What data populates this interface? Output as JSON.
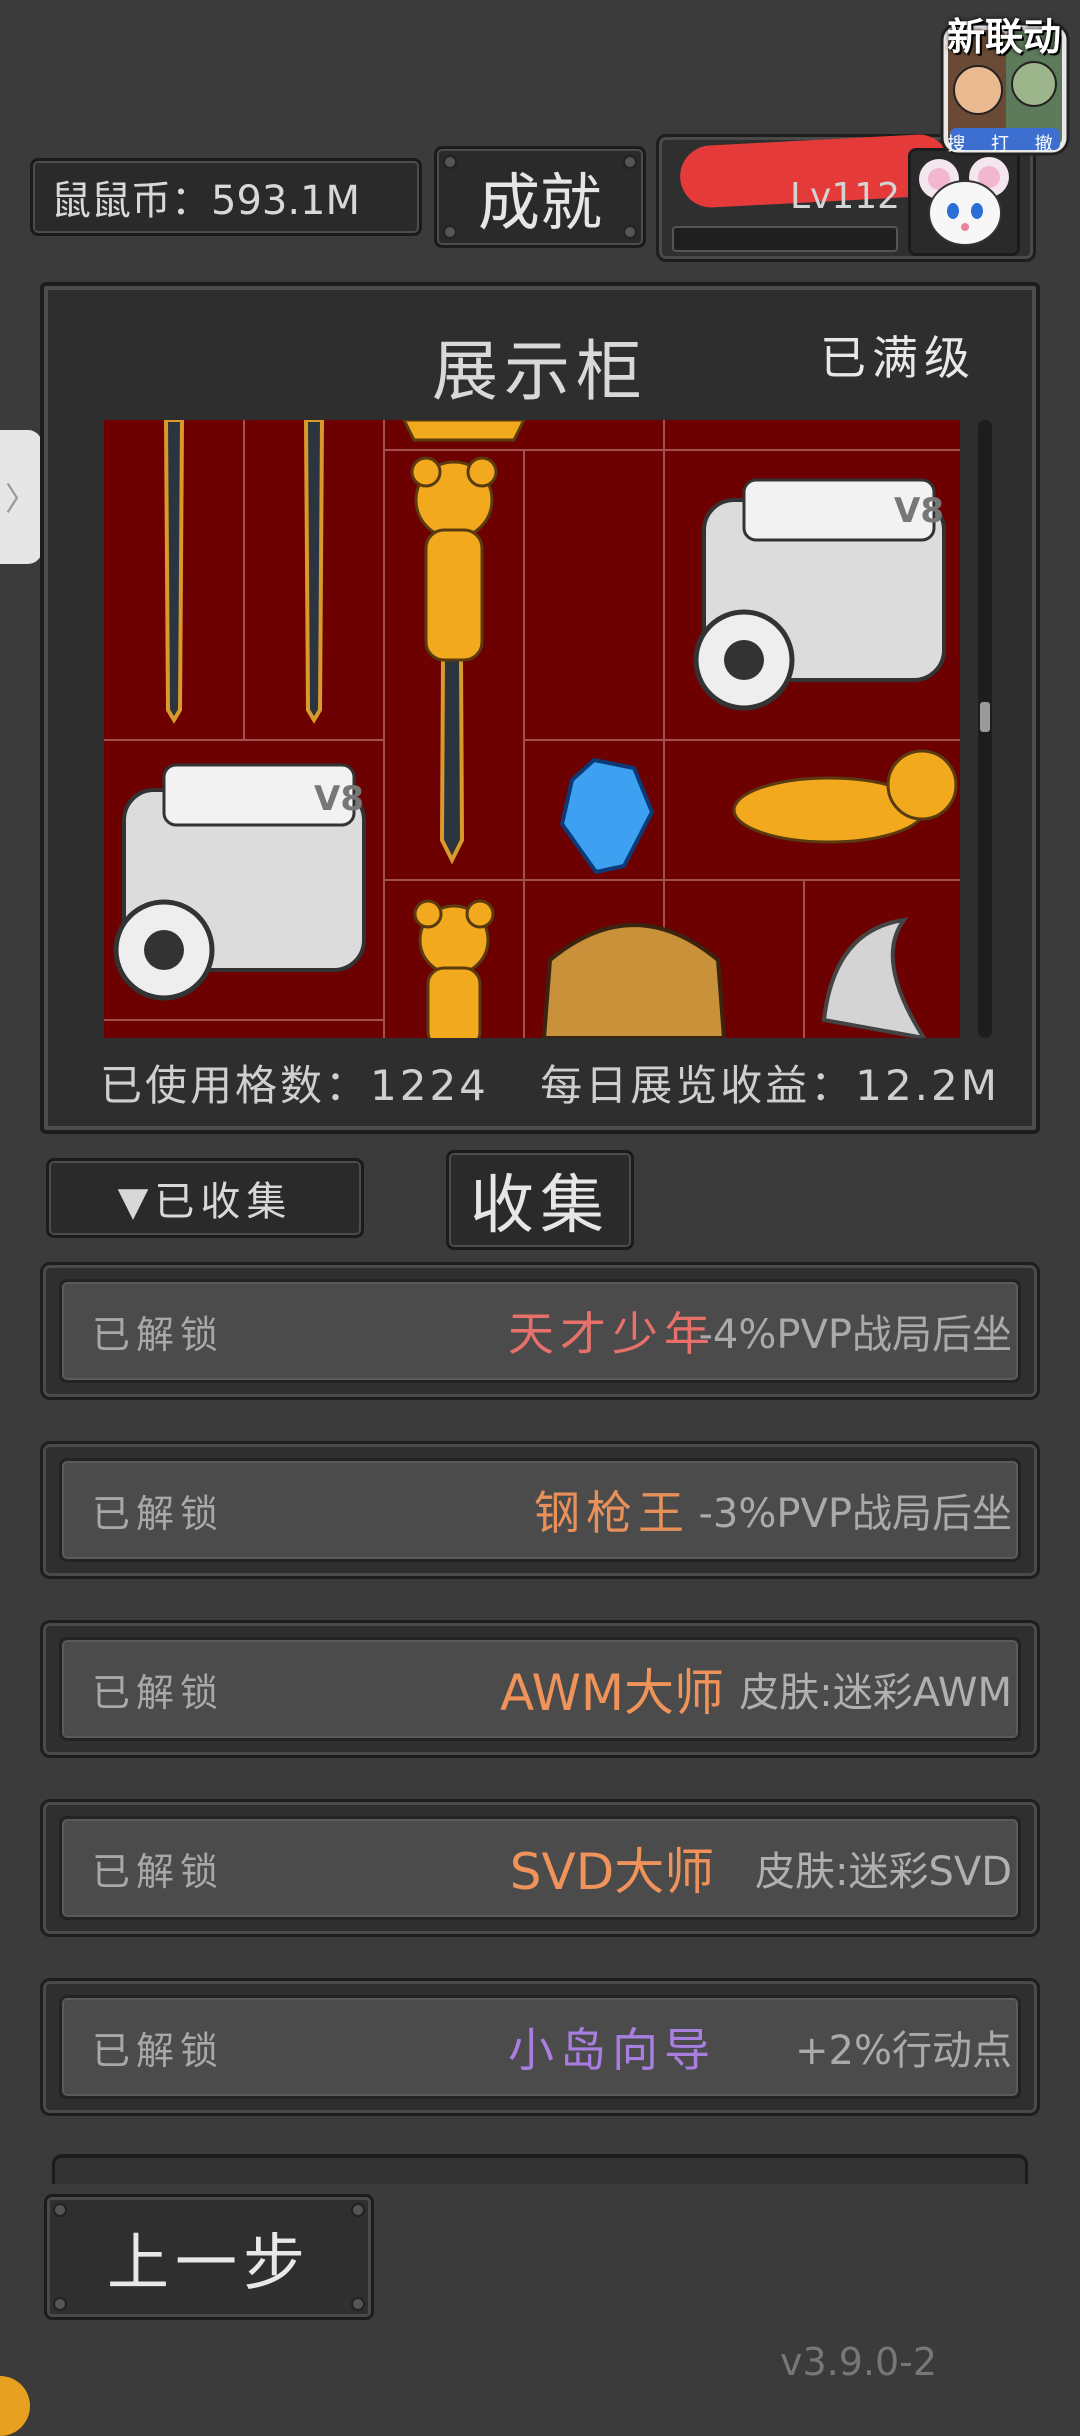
{
  "top_bar": {
    "coin_label": "鼠鼠币：593.1M",
    "achievement_button": "成就",
    "player_level": "Lv112",
    "event_label": "新联动",
    "event_sublabels": "搜 打 撤"
  },
  "cabinet": {
    "title": "展示柜",
    "status": "已满级",
    "used_slots_label": "已使用格数：1224",
    "daily_income_label": "每日展览收益：12.2M"
  },
  "tabs": {
    "collected_dropdown": "▼已收集",
    "collect_button": "收集"
  },
  "achievements": [
    {
      "status": "已解锁",
      "title": "天才少年",
      "reward": "-4%PVP战局后坐",
      "color": "#e8706a"
    },
    {
      "status": "已解锁",
      "title": "钢枪王",
      "reward": "-3%PVP战局后坐",
      "color": "#e8905a"
    },
    {
      "status": "已解锁",
      "title": "AWM大师",
      "reward": "皮肤:迷彩AWM",
      "color": "#f0935a"
    },
    {
      "status": "已解锁",
      "title": "SVD大师",
      "reward": "皮肤:迷彩SVD",
      "color": "#f0935a"
    },
    {
      "status": "已解锁",
      "title": "小岛向导",
      "reward": "+2%行动点",
      "color": "#a87fe0"
    }
  ],
  "bottom": {
    "back_button": "上一步",
    "version": "v3.9.0-2"
  },
  "colors": {
    "background": "#3b3b3b",
    "grid_background": "#6d0000",
    "redaction": "#e53a3a"
  }
}
